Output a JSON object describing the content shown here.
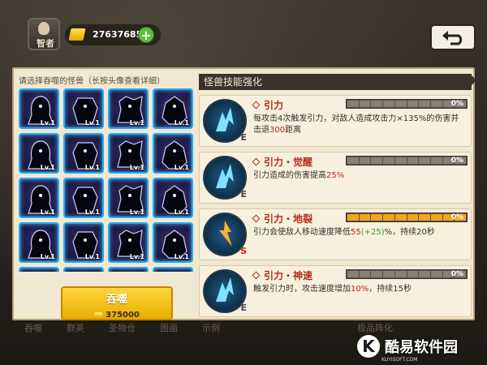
{
  "hud": {
    "hero_label": "智者",
    "gold_amount": "27637685",
    "plus_label": "+",
    "back_icon": "back-arrow-icon"
  },
  "bottom_tabs": [
    "吞噬",
    "群英",
    "圣物仓",
    "图画",
    "示例",
    "极品阵化"
  ],
  "picker": {
    "hint": "请选择吞噬的怪兽（长按头像查看详细）",
    "monsters": [
      {
        "level": "Lv.1"
      },
      {
        "level": "Lv.1"
      },
      {
        "level": "Lv.1"
      },
      {
        "level": "Lv.1"
      },
      {
        "level": "Lv.1"
      },
      {
        "level": "Lv.1"
      },
      {
        "level": "Lv.1"
      },
      {
        "level": "Lv.1"
      },
      {
        "level": "Lv.1"
      },
      {
        "level": "Lv.1"
      },
      {
        "level": "Lv.1"
      },
      {
        "level": "Lv.1"
      },
      {
        "level": "Lv.1"
      },
      {
        "level": "Lv.1"
      },
      {
        "level": "Lv.1"
      },
      {
        "level": "Lv.1"
      },
      {
        "level": ""
      },
      {
        "level": ""
      },
      {
        "level": ""
      },
      {
        "level": ""
      }
    ],
    "devour_label": "吞噬",
    "devour_cost": "375000"
  },
  "skills_panel": {
    "title": "怪兽技能强化",
    "skills": [
      {
        "name": "引力",
        "grade": "E",
        "progress": "0%",
        "active": false,
        "desc_parts": [
          {
            "text": "每攻击4次触发引力，对敌人造成攻击力×135%的伤害并击退",
            "color": "normal"
          },
          {
            "text": "300",
            "color": "red"
          },
          {
            "text": "距离",
            "color": "normal"
          }
        ]
      },
      {
        "name": "引力・觉醒",
        "grade": "E",
        "progress": "0%",
        "active": false,
        "desc_parts": [
          {
            "text": "引力造成的伤害提高",
            "color": "normal"
          },
          {
            "text": "25%",
            "color": "red"
          }
        ]
      },
      {
        "name": "引力・地裂",
        "grade": "S",
        "progress": "0%",
        "active": true,
        "desc_parts": [
          {
            "text": "引力会使敌人移动速度降低",
            "color": "normal"
          },
          {
            "text": "55",
            "color": "red"
          },
          {
            "text": "(+25)",
            "color": "green"
          },
          {
            "text": "%，持续20秒",
            "color": "normal"
          }
        ]
      },
      {
        "name": "引力・神速",
        "grade": "E",
        "progress": "0%",
        "active": false,
        "desc_parts": [
          {
            "text": "触发引力时，攻击速度增加",
            "color": "normal"
          },
          {
            "text": "10%",
            "color": "red"
          },
          {
            "text": "，持续15秒",
            "color": "normal"
          }
        ]
      }
    ]
  },
  "watermark": {
    "logo": "K",
    "text": "酷易软件园",
    "sub": "KUYISOFT.COM"
  }
}
